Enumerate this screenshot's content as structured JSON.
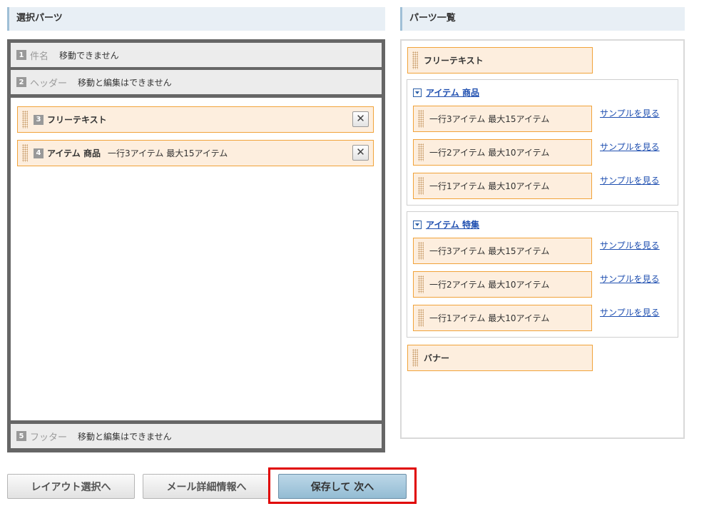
{
  "left_panel": {
    "title": "選択パーツ",
    "fixed_rows": [
      {
        "num": "1",
        "name": "件名",
        "note": "移動できません"
      },
      {
        "num": "2",
        "name": "ヘッダー",
        "note": "移動と編集はできません"
      },
      {
        "num": "5",
        "name": "フッター",
        "note": "移動と編集はできません"
      }
    ],
    "selected_items": [
      {
        "num": "3",
        "title": "フリーテキスト",
        "desc": "",
        "remove": "✕"
      },
      {
        "num": "4",
        "title": "アイテム 商品",
        "desc": "一行3アイテム 最大15アイテム",
        "remove": "✕"
      }
    ]
  },
  "right_panel": {
    "title": "パーツ一覧",
    "free_text": "フリーテキスト",
    "banner": "バナー",
    "sample_link": "サンプルを見る",
    "groups": [
      {
        "title": "アイテム 商品",
        "items": [
          "一行3アイテム 最大15アイテム",
          "一行2アイテム 最大10アイテム",
          "一行1アイテム 最大10アイテム"
        ]
      },
      {
        "title": "アイテム 特集",
        "items": [
          "一行3アイテム 最大15アイテム",
          "一行2アイテム 最大10アイテム",
          "一行1アイテム 最大10アイテム"
        ]
      }
    ]
  },
  "buttons": {
    "layout": "レイアウト選択へ",
    "mail": "メール詳細情報へ",
    "save": "保存して 次へ"
  },
  "colors": {
    "part_bg": "#fdeede",
    "part_border": "#f1a33a",
    "link": "#1f4fb0",
    "highlight": "#e00000",
    "save_button": "#a8c9dd"
  }
}
